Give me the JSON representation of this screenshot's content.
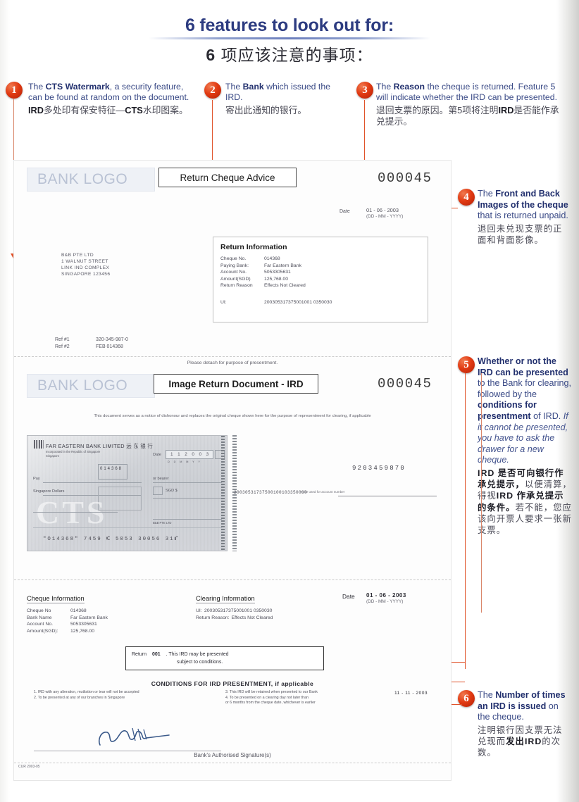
{
  "title": {
    "english": "6 features to look out for:",
    "chinese_number": "6",
    "chinese_rest": " 项应该注意的事项："
  },
  "features": [
    {
      "number": "1",
      "en_parts": [
        {
          "t": "The ",
          "style": "normal"
        },
        {
          "t": "CTS Watermark",
          "style": "bold"
        },
        {
          "t": ", a security feature, can be found at random on the document.",
          "style": "normal"
        }
      ],
      "zh_parts": [
        {
          "t": "IRD",
          "style": "bold"
        },
        {
          "t": "多处印有保安特",
          "style": "normal"
        },
        {
          "t": "征—",
          "style": "normal"
        },
        {
          "t": "CTS",
          "style": "bold"
        },
        {
          "t": "水印图案。",
          "style": "normal"
        }
      ]
    },
    {
      "number": "2",
      "en_parts": [
        {
          "t": "The ",
          "style": "normal"
        },
        {
          "t": "Bank",
          "style": "bold"
        },
        {
          "t": " which issued the IRD.",
          "style": "normal"
        }
      ],
      "zh_parts": [
        {
          "t": "寄出此通知的银行。",
          "style": "normal"
        }
      ]
    },
    {
      "number": "3",
      "en_parts": [
        {
          "t": "The ",
          "style": "normal"
        },
        {
          "t": "Reason",
          "style": "bold"
        },
        {
          "t": " the cheque is returned. Feature 5 will indicate whether the IRD can be presented.",
          "style": "normal"
        }
      ],
      "zh_parts": [
        {
          "t": "退回支票的原因。第5项将注明",
          "style": "normal"
        },
        {
          "t": "IRD",
          "style": "bold"
        },
        {
          "t": "是否能作承兑提示。",
          "style": "normal"
        }
      ]
    },
    {
      "number": "4",
      "en_parts": [
        {
          "t": "The ",
          "style": "normal"
        },
        {
          "t": "Front and Back Images of the cheque",
          "style": "bold"
        },
        {
          "t": " that is returned unpaid.",
          "style": "normal"
        }
      ],
      "zh_parts": [
        {
          "t": "退回未兑现支票的正面和背面影像。",
          "style": "normal"
        }
      ]
    },
    {
      "number": "5",
      "en_parts": [
        {
          "t": "Whether or not the IRD can be presented",
          "style": "bold"
        },
        {
          "t": " to the Bank for clearing, followed by the ",
          "style": "normal"
        },
        {
          "t": "conditions for presentment",
          "style": "bold"
        },
        {
          "t": " of IRD. ",
          "style": "normal"
        },
        {
          "t": "If it cannot be presented, you have to ask the drawer for a new cheque.",
          "style": "italic"
        }
      ],
      "zh_parts": [
        {
          "t": "IRD 是否可向银行作承兑提示，",
          "style": "bold"
        },
        {
          "t": "以便清算，得视",
          "style": "normal"
        },
        {
          "t": "IRD 作承兑提示的条件。",
          "style": "bold"
        },
        {
          "t": "若不能，您应该向开票人要求一张新支票。",
          "style": "normal"
        }
      ]
    },
    {
      "number": "6",
      "en_parts": [
        {
          "t": "The ",
          "style": "normal"
        },
        {
          "t": "Number of times an IRD is issued",
          "style": "bold"
        },
        {
          "t": " on the cheque.",
          "style": "normal"
        }
      ],
      "zh_parts": [
        {
          "t": "注明银行因支票无法兑现而",
          "style": "normal"
        },
        {
          "t": "发出",
          "style": "bold"
        },
        {
          "t": "IRD",
          "style": "bold"
        },
        {
          "t": "的次数。",
          "style": "normal"
        }
      ]
    }
  ],
  "document": {
    "advice": {
      "bank_logo": "BANK LOGO",
      "doc_title": "Return Cheque Advice",
      "serial": "000045",
      "date_label": "Date",
      "date_value": "01 - 06 - 2003",
      "date_format": "(DD - MM - YYYY)",
      "address": [
        "B&B PTE LTD",
        "1 WALNUT STREET",
        "LINK IND COMPLEX",
        "SINGAPORE 123456"
      ],
      "refs": [
        {
          "label": "Ref #1",
          "value": "320-345-987-0"
        },
        {
          "label": "Ref #2",
          "value": "FEB 014368"
        }
      ],
      "return_info": {
        "heading": "Return Information",
        "rows": [
          {
            "label": "Cheque No.",
            "value": "014368"
          },
          {
            "label": "Paying Bank:",
            "value": "Far Eastern Bank"
          },
          {
            "label": "Account No.",
            "value": "5053305631"
          },
          {
            "label": "Amount(SGD)",
            "value": "125,768.00"
          },
          {
            "label": "Return Reason",
            "value": "Effects Not Cleared"
          }
        ],
        "ui_label": "UI:",
        "ui_value": "200305317375001001 0350030"
      }
    },
    "detach_note": "Please detach for purpose of presentment.",
    "ird": {
      "bank_logo": "BANK LOGO",
      "doc_title": "Image Return Document - IRD",
      "serial": "000045",
      "notice": "This document serves as a notice of dishonour and replaces the original cheque shown here for the purpose of representment for clearing, if applicable",
      "cheque_image": {
        "bank_name": "FAR EASTERN BANK LIMITED 远 东 银 行",
        "bank_sub": "Incorporated in the Republic of Singapore",
        "branch": "Singapore",
        "date_label": "Date",
        "date_boxes": "1 1 2 0 0 3",
        "date_sub": "D  D   M  M   Y  Y",
        "pay_label": "Pay",
        "order_label": "or bearer",
        "amount_words_label": "Singapore Dollars",
        "amount_label": "SGD $",
        "watermark": "CTS",
        "micr": "\"O14368\" 7459 ⑆ 5053 30056 31⑈",
        "account_name": "B&B PTE LTD"
      },
      "back_image": {
        "endorsement_number": "9203459870",
        "ui_value": "20030531737500100103350030",
        "note": "To be used for account number"
      }
    },
    "cheque_info": {
      "heading": "Cheque Information",
      "rows": [
        {
          "label": "Cheque No",
          "value": "014368"
        },
        {
          "label": "Bank Name",
          "value": "Far Eastern Bank"
        },
        {
          "label": "Account No.",
          "value": "5053305631"
        },
        {
          "label": "Amount(SGD):",
          "value": "125,768.00"
        }
      ]
    },
    "clearing_info": {
      "heading": "Clearing Information",
      "ui_label": "UI:",
      "ui_value": "200305317375001001 0350030",
      "reason_label": "Return Reason:",
      "reason_value": "Effects Not Cleared",
      "date_label": "Date",
      "date_value": "01 - 06 - 2003",
      "date_format": "(DD - MM - YYYY)"
    },
    "return_statement": {
      "prefix": "Return",
      "count": "001",
      "text_line1": ".  This IRD may be presented",
      "text_line2": "subject to conditions."
    },
    "conditions": {
      "title": "CONDITIONS FOR IRD PRESENTMENT, if applicable",
      "left": [
        "1.  IRD with any alteration, mutilation or tear will not be accepted",
        "2.  To be presented at any of our branches in Singapore"
      ],
      "right": [
        "3.  This IRD will be retained when presented to our Bank",
        "4.  To be presented on a clearing day not later than",
        "     or 6 months from the cheque date, whichever is earlier"
      ],
      "expiry_date": "11 - 11 - 2003"
    },
    "signature_caption": "Bank's Authorised Signature(s)",
    "footer_code": "CUR 2003-05"
  },
  "colors": {
    "title_blue": "#2c3b80",
    "callout_blue": "#3a4a86",
    "accent_orange": "#e0532a",
    "bullet_red": "#d02f0c"
  }
}
